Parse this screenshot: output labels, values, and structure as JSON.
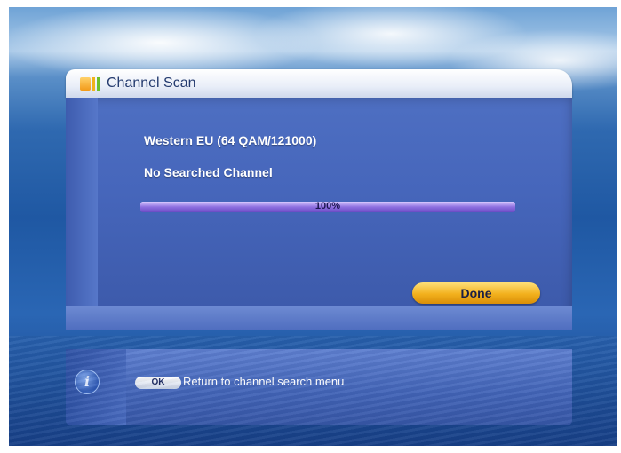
{
  "title": "Channel Scan",
  "scan": {
    "network": "Western EU (64 QAM/121000)",
    "status": "No Searched Channel",
    "progress_percent": 100,
    "progress_label": "100%"
  },
  "buttons": {
    "done_label": "Done"
  },
  "help": {
    "key_label": "OK",
    "text": "Return to channel search menu"
  },
  "icons": {
    "title_icon": "channel-scan-icon",
    "info_icon": "info-icon"
  },
  "colors": {
    "panel": "#4666bb",
    "accent_button": "#f2b01c",
    "progress": "#7c5fcf"
  }
}
